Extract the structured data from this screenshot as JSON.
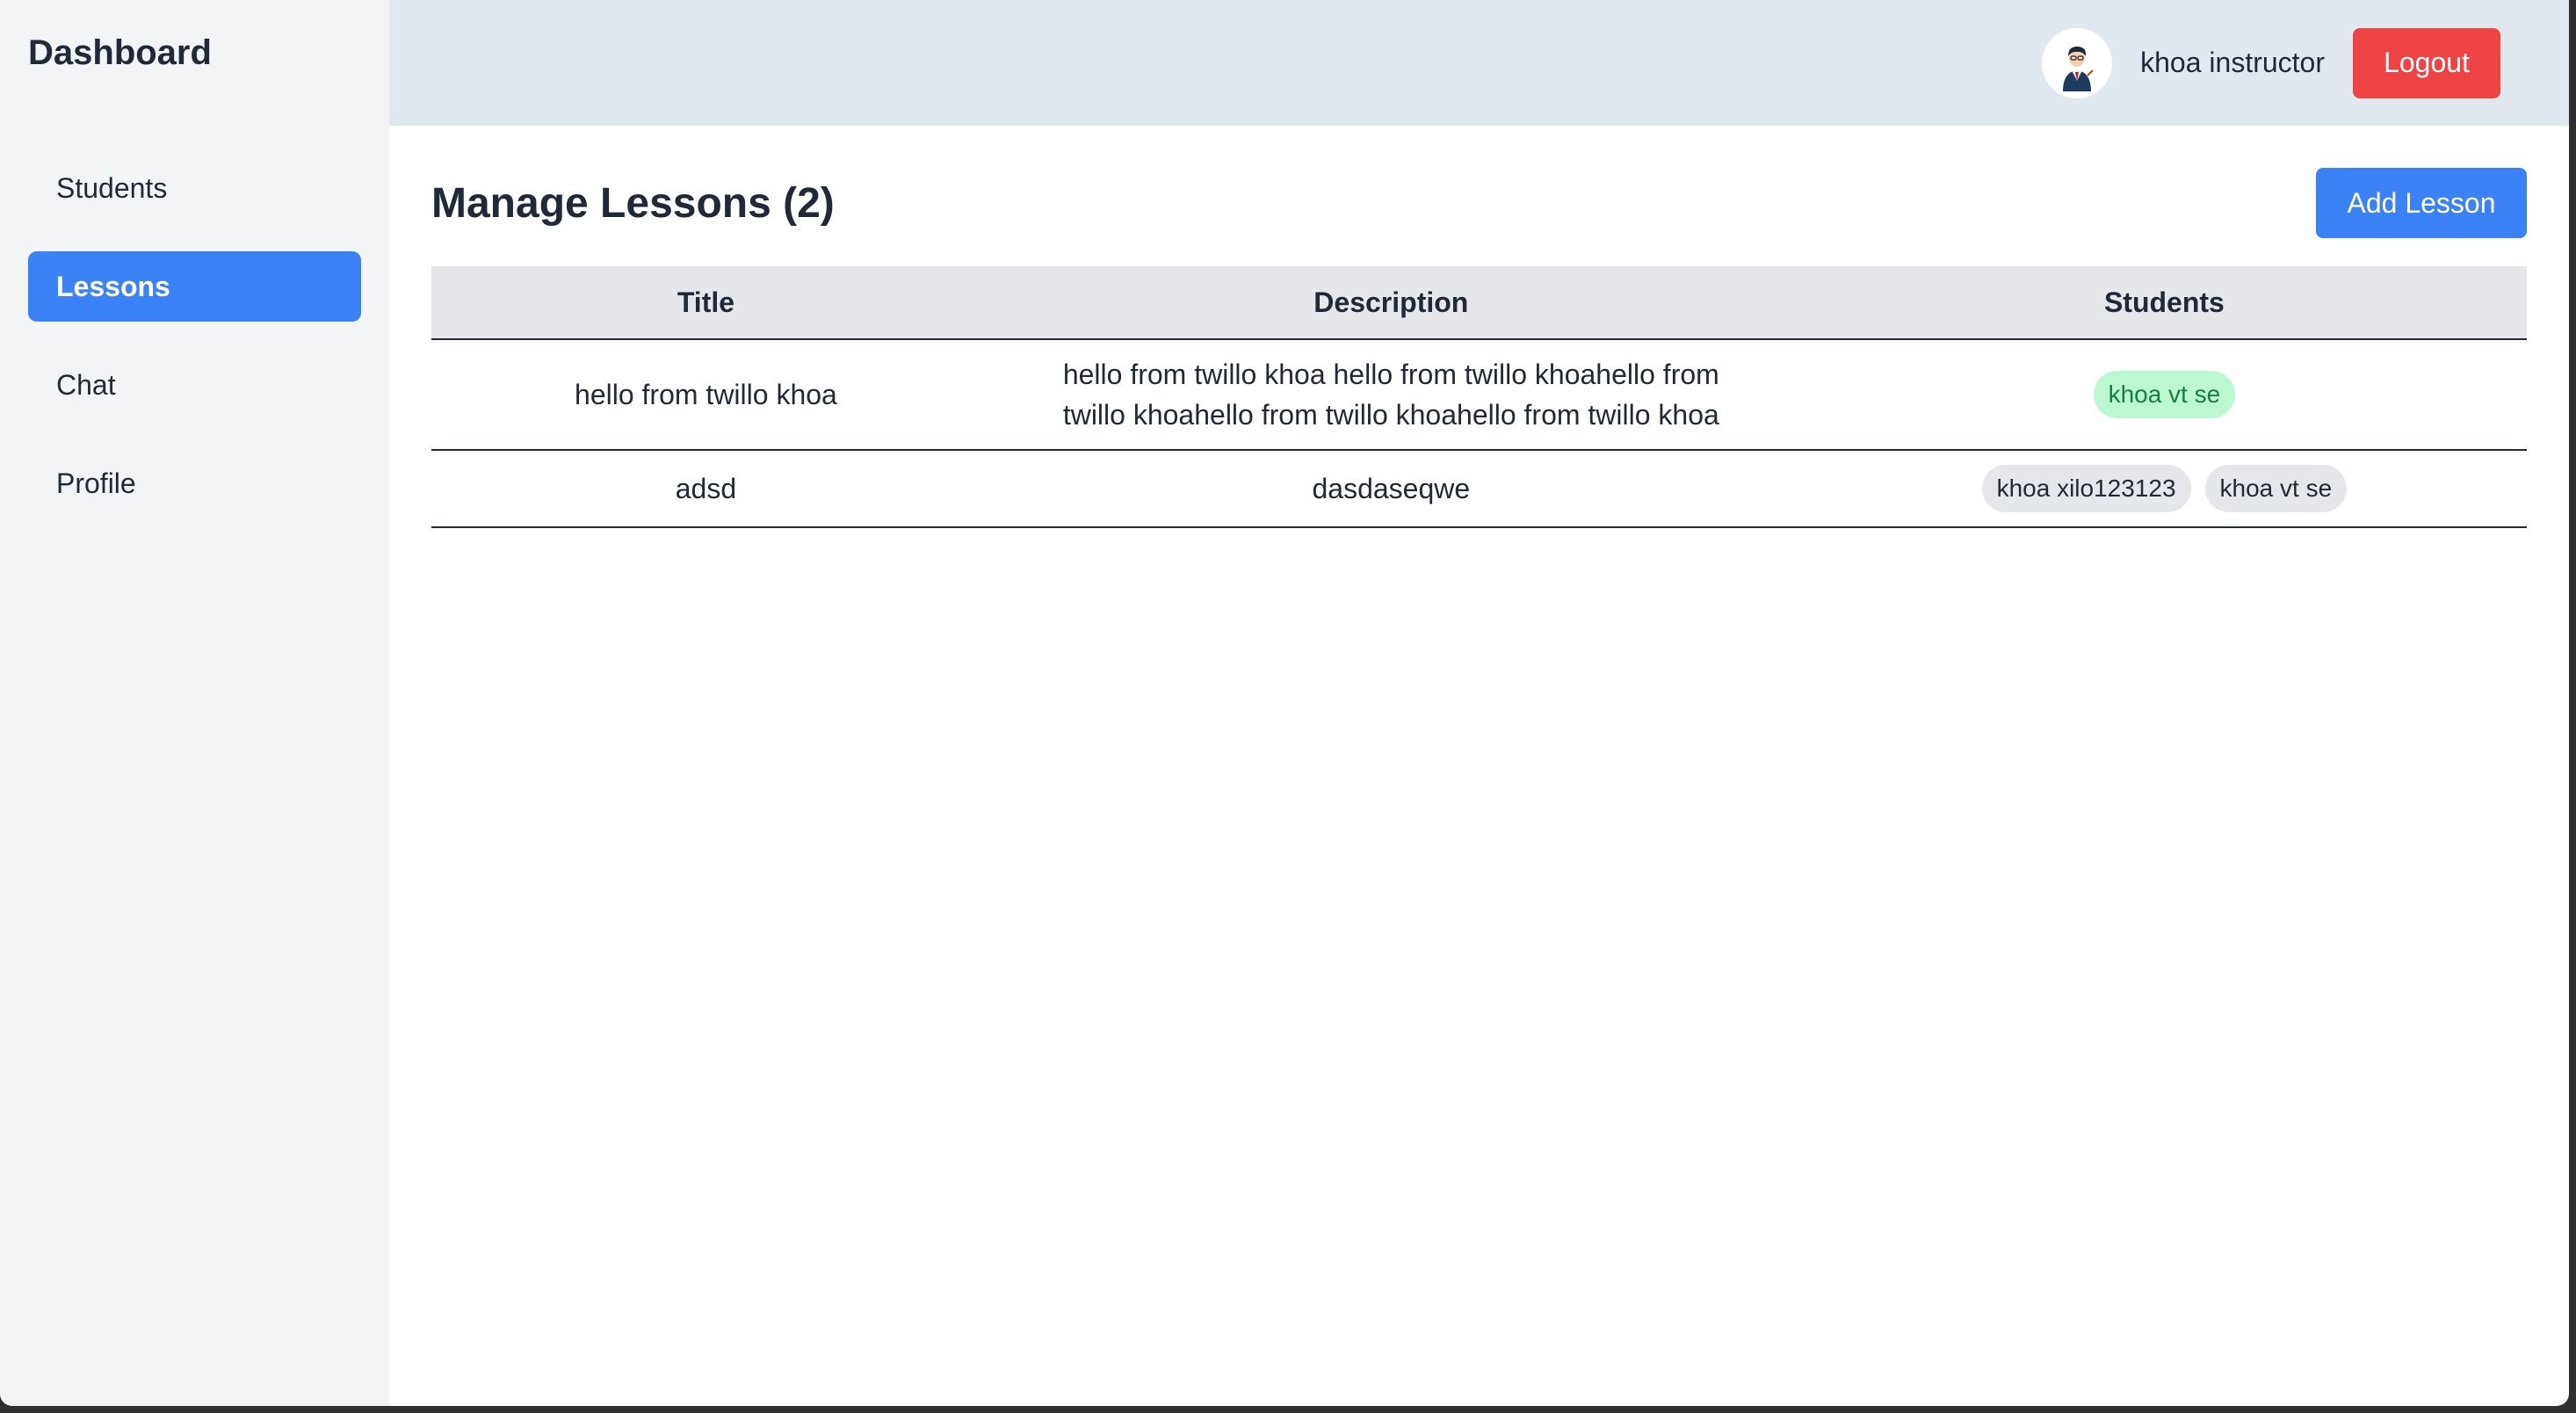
{
  "sidebar": {
    "brand": "Dashboard",
    "items": [
      {
        "label": "Students",
        "active": false
      },
      {
        "label": "Lessons",
        "active": true
      },
      {
        "label": "Chat",
        "active": false
      },
      {
        "label": "Profile",
        "active": false
      }
    ]
  },
  "header": {
    "username": "khoa instructor",
    "logout_label": "Logout",
    "avatar_icon": "user-avatar-icon"
  },
  "main": {
    "title": "Manage Lessons (2)",
    "add_label": "Add Lesson",
    "table": {
      "columns": [
        "Title",
        "Description",
        "Students"
      ],
      "rows": [
        {
          "title": "hello from twillo khoa",
          "description": "hello from twillo khoa hello from twillo khoahello from twillo khoahello from twillo khoahello from twillo khoa",
          "students": [
            {
              "name": "khoa vt se",
              "color": "#bbf7d0"
            }
          ]
        },
        {
          "title": "adsd",
          "description": "dasdaseqwe",
          "students": [
            {
              "name": "khoa xilo123123",
              "color": "#e5e7eb"
            },
            {
              "name": "khoa vt se",
              "color": "#e5e7eb"
            }
          ]
        }
      ]
    }
  },
  "colors": {
    "primary": "#3b82f6",
    "danger": "#ef4444",
    "sidebar_bg": "#f3f4f6",
    "topbar_bg": "#e2e8f0"
  }
}
